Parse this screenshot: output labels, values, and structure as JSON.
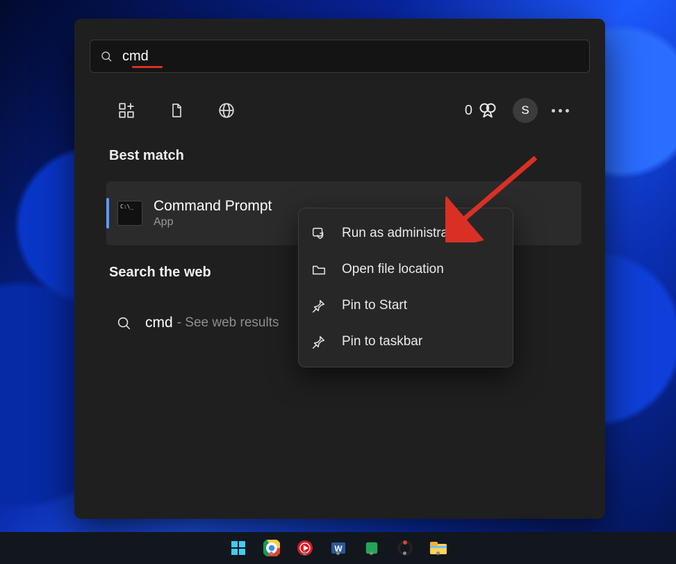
{
  "search": {
    "value": "cmd"
  },
  "rewards": {
    "points": "0"
  },
  "avatar": {
    "letter": "S"
  },
  "groups": {
    "best_match": "Best match",
    "search_web": "Search the web"
  },
  "best": {
    "name": "Command Prompt",
    "subtitle": "App"
  },
  "web": {
    "query": "cmd",
    "desc": "- See web results"
  },
  "context_menu": {
    "items": [
      {
        "label": "Run as administrator"
      },
      {
        "label": "Open file location"
      },
      {
        "label": "Pin to Start"
      },
      {
        "label": "Pin to taskbar"
      }
    ]
  }
}
